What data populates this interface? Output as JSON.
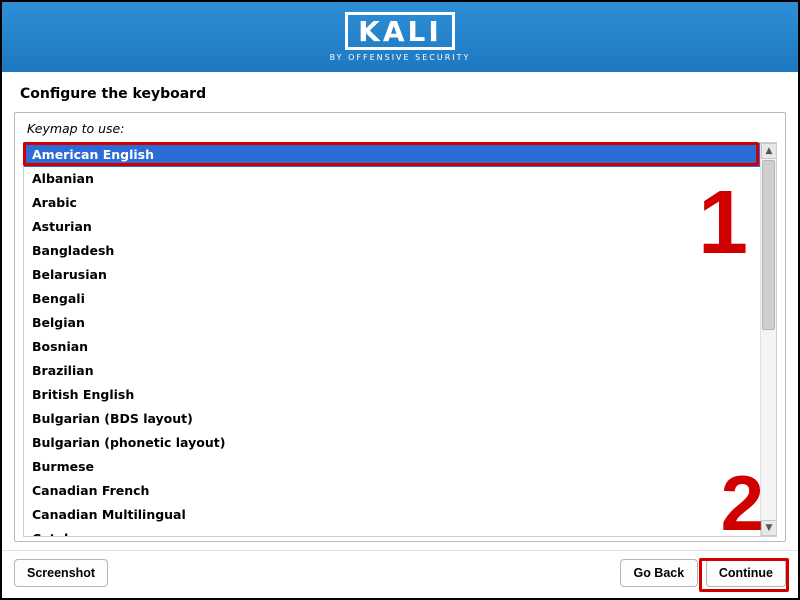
{
  "header": {
    "logo_text": "KALI",
    "logo_subtitle": "BY OFFENSIVE SECURITY"
  },
  "page": {
    "title": "Configure the keyboard",
    "prompt": "Keymap to use:"
  },
  "list": {
    "selected_index": 0,
    "items": [
      "American English",
      "Albanian",
      "Arabic",
      "Asturian",
      "Bangladesh",
      "Belarusian",
      "Bengali",
      "Belgian",
      "Bosnian",
      "Brazilian",
      "British English",
      "Bulgarian (BDS layout)",
      "Bulgarian (phonetic layout)",
      "Burmese",
      "Canadian French",
      "Canadian Multilingual",
      "Catalan"
    ]
  },
  "footer": {
    "screenshot": "Screenshot",
    "go_back": "Go Back",
    "continue": "Continue"
  },
  "annotations": {
    "one": "1",
    "two": "2"
  }
}
